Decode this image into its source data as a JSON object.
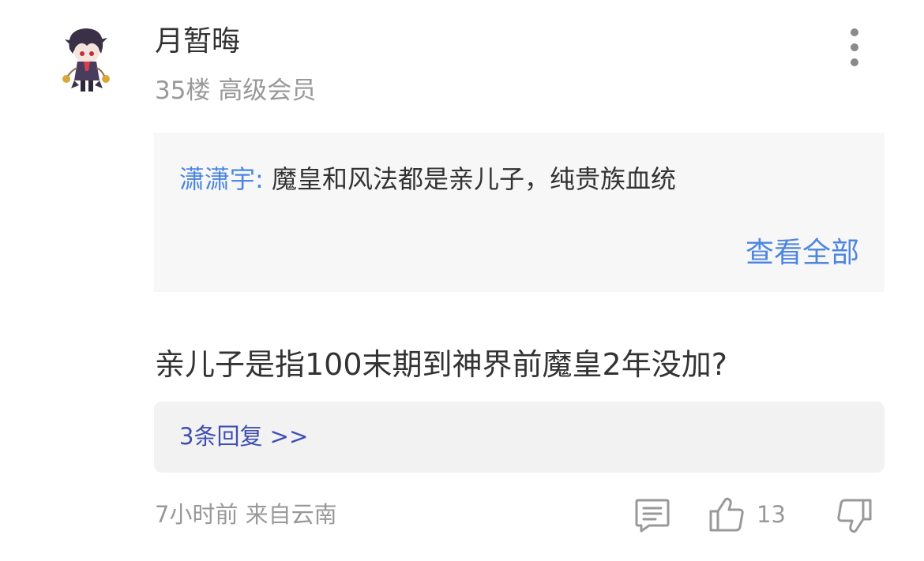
{
  "post": {
    "username": "月暂晦",
    "floor": "35楼",
    "level": "高级会员",
    "quote": {
      "author": "潇潇宇:",
      "text": "魔皇和风法都是亲儿子，纯贵族血统",
      "view_all": "查看全部"
    },
    "content": "亲儿子是指100末期到神界前魔皇2年没加?",
    "replies": "3条回复 >>",
    "time": "7小时前",
    "location": "来自云南",
    "likes": "13"
  },
  "icons": {
    "avatar": "chibi-character-avatar",
    "more": "more-vertical-icon",
    "comment": "comment-icon",
    "like": "thumbs-up-icon",
    "dislike": "thumbs-down-icon"
  },
  "colors": {
    "link_blue": "#4d86e0",
    "reply_link": "#3f4fb0",
    "muted": "#999999",
    "text": "#333333"
  }
}
